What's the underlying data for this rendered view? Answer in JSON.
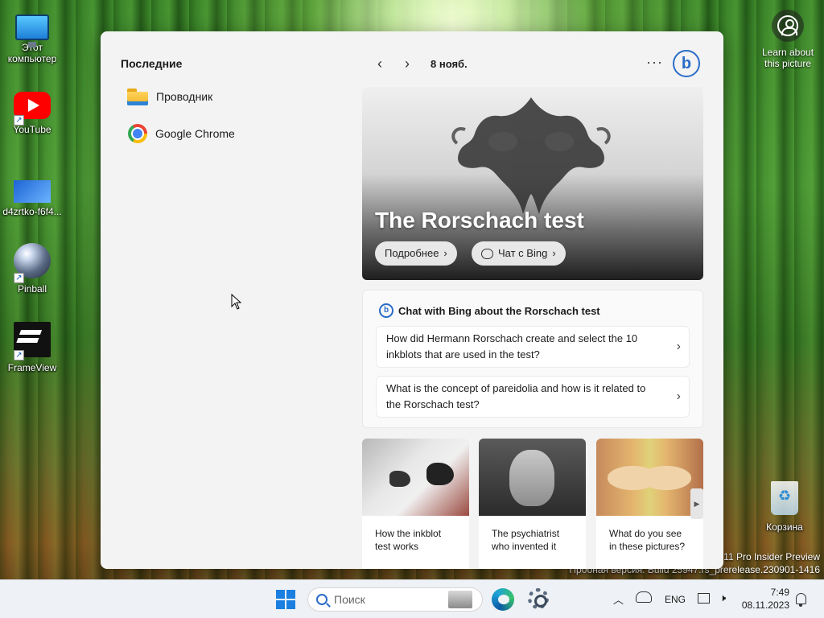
{
  "desktop": {
    "icons": [
      {
        "label": "Этот компьютер"
      },
      {
        "label": "YouTube"
      },
      {
        "label": "d4zrtko-f6f4..."
      },
      {
        "label": "Pinball"
      },
      {
        "label": "FrameView"
      },
      {
        "label": "Корзина"
      }
    ],
    "learn_about": "Learn about this picture",
    "watermark_line1": "11 Pro Insider Preview",
    "watermark_line2": "Пробная версия. Build 25947.rs_prerelease.230901-1416"
  },
  "panel": {
    "recent_title": "Последние",
    "recent_items": [
      {
        "label": "Проводник",
        "icon": "folder-icon"
      },
      {
        "label": "Google Chrome",
        "icon": "chrome-icon"
      }
    ],
    "nav": {
      "prev": "‹",
      "next": "›",
      "date": "8 нояб."
    },
    "more": "···",
    "bing_logo": "b",
    "hero": {
      "title": "The Rorschach test",
      "more_button": "Подробнее",
      "chat_button": "Чат с Bing"
    },
    "chat": {
      "heading": "Chat with Bing about the Rorschach test",
      "questions": [
        "How did Hermann Rorschach create and select the 10 inkblots that are used in the test?",
        "What is the concept of pareidolia and how is it related to the Rorschach test?"
      ]
    },
    "thumbnails": [
      {
        "caption": "How the inkblot test works"
      },
      {
        "caption": "The psychiatrist who invented it"
      },
      {
        "caption": "What do you see in these pictures?"
      }
    ]
  },
  "taskbar": {
    "search_placeholder": "Поиск",
    "language": "ENG",
    "time": "7:49",
    "date": "08.11.2023"
  }
}
